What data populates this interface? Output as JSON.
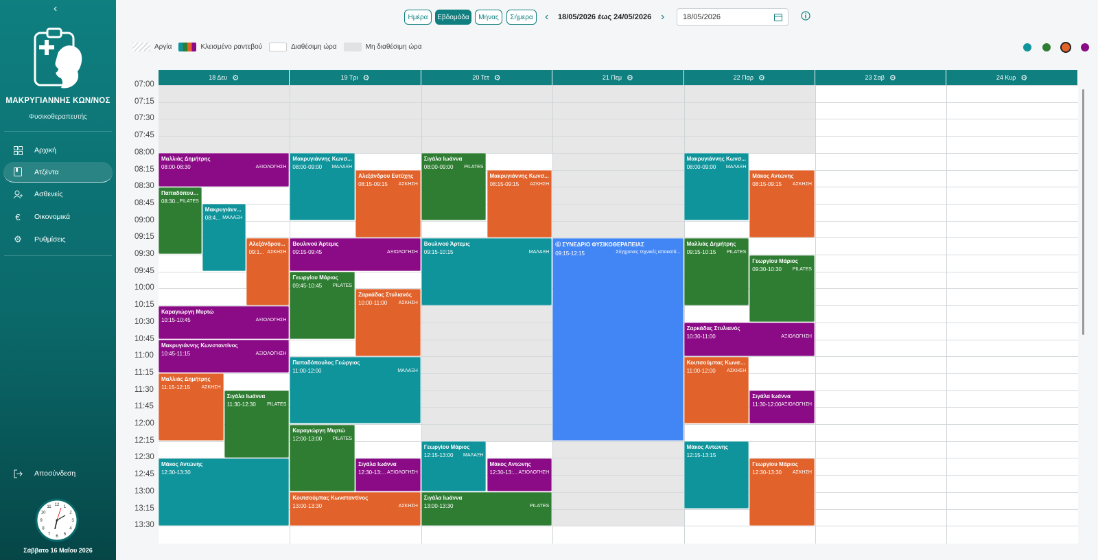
{
  "sidebar": {
    "collapse_icon": "‹",
    "doctor_name": "ΜΑΚΡΥΓΙΑΝΝΗΣ ΚΩΝ/ΝΟΣ",
    "doctor_role": "Φυσικοθεραπευτής",
    "items": [
      {
        "label": "Αρχική",
        "icon": "dashboard-icon"
      },
      {
        "label": "Ατζέντα",
        "icon": "calendar-icon",
        "active": true
      },
      {
        "label": "Ασθενείς",
        "icon": "patients-icon"
      },
      {
        "label": "Οικονομικά",
        "icon": "euro-icon"
      },
      {
        "label": "Ρυθμίσεις",
        "icon": "gear-icon"
      }
    ],
    "logout_label": "Αποσύνδεση",
    "clock_numbers": [
      "12",
      "1",
      "2",
      "3",
      "4",
      "5",
      "6",
      "7",
      "8",
      "9",
      "10",
      "11"
    ],
    "date_label": "Σάββατο 16 Μαΐου 2026"
  },
  "toolbar": {
    "view_buttons": [
      "Ημέρα",
      "Εβδομάδα",
      "Μήνας",
      "Σήμερα"
    ],
    "active_view": "Εβδομάδα",
    "prev": "‹",
    "next": "›",
    "range": "18/05/2026 έως 24/05/2026",
    "date_value": "18/05/2026"
  },
  "legend": {
    "holiday": "Αργία",
    "booked": "Κλεισμένο ραντεβού",
    "available": "Διαθέσιμη ώρα",
    "unavailable": "Μη διαθέσιμη ώρα"
  },
  "colors": {
    "primary": "#0f7f80",
    "purple": "#8b0a86",
    "teal": "#10949c",
    "orange": "#e1622a",
    "green": "#2e7d32",
    "blue": "#4285f4"
  },
  "filter_dots": [
    "#10949c",
    "#2e7d32",
    "#e1622a",
    "#8b0a86"
  ],
  "days": [
    "18 Δευ",
    "19 Τρι",
    "20 Τετ",
    "21 Πεμ",
    "22 Παρ",
    "23 Σαβ",
    "24 Κυρ"
  ],
  "times": [
    "07:00",
    "07:15",
    "07:30",
    "07:45",
    "08:00",
    "08:15",
    "08:30",
    "08:45",
    "09:00",
    "09:15",
    "09:30",
    "09:45",
    "10:00",
    "10:15",
    "10:30",
    "10:45",
    "11:00",
    "11:15",
    "11:30",
    "11:45",
    "12:00",
    "12:15",
    "12:30",
    "12:45",
    "13:00",
    "13:15",
    "13:30"
  ],
  "events": [
    {
      "day": 0,
      "start": "08:00",
      "end": "08:30",
      "sub": 0,
      "subs": 1,
      "color": "purple",
      "name": "Μαλλιάς Δημήτρης",
      "time": "08:00-08:30",
      "type": "ΑΞΙΟΛΟΓΗΣΗ"
    },
    {
      "day": 0,
      "start": "08:30",
      "end": "09:30",
      "sub": 0,
      "subs": 3,
      "color": "green",
      "name": "Παπαδόπουλ...",
      "time": "08:30...",
      "type": "PILATES"
    },
    {
      "day": 0,
      "start": "08:45",
      "end": "09:45",
      "sub": 1,
      "subs": 3,
      "color": "teal",
      "name": "Μακρυγιάνν...",
      "time": "08:4...",
      "type": "ΜΑΛΑΞΗ"
    },
    {
      "day": 0,
      "start": "09:15",
      "end": "10:15",
      "sub": 2,
      "subs": 3,
      "color": "orange",
      "name": "Αλεξάνδρου...",
      "time": "09:1...",
      "type": "ΑΣΚΗΣΗ"
    },
    {
      "day": 0,
      "start": "10:15",
      "end": "10:45",
      "sub": 0,
      "subs": 1,
      "color": "purple",
      "name": "Καραγιώργη Μυρτώ",
      "time": "10:15-10:45",
      "type": "ΑΞΙΟΛΟΓΗΣΗ"
    },
    {
      "day": 0,
      "start": "10:45",
      "end": "11:15",
      "sub": 0,
      "subs": 1,
      "color": "purple",
      "name": "Μακρυγιάννης Κωνσταντίνος",
      "time": "10:45-11:15",
      "type": "ΑΞΙΟΛΟΓΗΣΗ"
    },
    {
      "day": 0,
      "start": "11:15",
      "end": "12:15",
      "sub": 0,
      "subs": 2,
      "color": "orange",
      "name": "Μαλλιάς Δημήτρης",
      "time": "11:15-12:15",
      "type": "ΑΣΚΗΣΗ"
    },
    {
      "day": 0,
      "start": "11:30",
      "end": "12:30",
      "sub": 1,
      "subs": 2,
      "color": "green",
      "name": "Σιγάλα Ιωάννα",
      "time": "11:30-12:30",
      "type": "PILATES"
    },
    {
      "day": 0,
      "start": "12:30",
      "end": "13:30",
      "sub": 0,
      "subs": 1,
      "color": "teal",
      "name": "Μάκος Αντώνης",
      "time": "12:30-13:30",
      "type": ""
    },
    {
      "day": 1,
      "start": "08:00",
      "end": "09:00",
      "sub": 0,
      "subs": 2,
      "color": "teal",
      "name": "Μακρυγιάννης Κωνσ...",
      "time": "08:00-09:00",
      "type": "ΜΑΛΑΞΗ"
    },
    {
      "day": 1,
      "start": "08:15",
      "end": "09:15",
      "sub": 1,
      "subs": 2,
      "color": "orange",
      "name": "Αλεξάνδρου Ευτύχης",
      "time": "08:15-09:15",
      "type": "ΑΣΚΗΣΗ"
    },
    {
      "day": 1,
      "start": "09:15",
      "end": "09:45",
      "sub": 0,
      "subs": 1,
      "color": "purple",
      "name": "Βουλινού Άρτεμις",
      "time": "09:15-09:45",
      "type": "ΑΞΙΟΛΟΓΗΣΗ"
    },
    {
      "day": 1,
      "start": "09:45",
      "end": "10:45",
      "sub": 0,
      "subs": 2,
      "color": "green",
      "name": "Γεωργίου Μάριος",
      "time": "09:45-10:45",
      "type": "PILATES"
    },
    {
      "day": 1,
      "start": "10:00",
      "end": "11:00",
      "sub": 1,
      "subs": 2,
      "color": "orange",
      "name": "Ζαρκάδας Στυλιανός",
      "time": "10:00-11:00",
      "type": "ΑΣΚΗΣΗ"
    },
    {
      "day": 1,
      "start": "11:00",
      "end": "12:00",
      "sub": 0,
      "subs": 1,
      "color": "teal",
      "name": "Παπαδόπουλος Γεώργιος",
      "time": "11:00-12:00",
      "type": "ΜΑΛΑΞΗ"
    },
    {
      "day": 1,
      "start": "12:00",
      "end": "13:00",
      "sub": 0,
      "subs": 2,
      "color": "green",
      "name": "Καραγιώργη Μυρτώ",
      "time": "12:00-13:00",
      "type": "PILATES"
    },
    {
      "day": 1,
      "start": "12:30",
      "end": "13:00",
      "sub": 1,
      "subs": 2,
      "color": "purple",
      "name": "Σιγάλα Ιωάννα",
      "time": "12:30-13:...",
      "type": "ΑΞΙΟΛΟΓΗΣΗ"
    },
    {
      "day": 1,
      "start": "13:00",
      "end": "13:30",
      "sub": 0,
      "subs": 1,
      "color": "orange",
      "name": "Κουτσούμπας Κωνσταντίνος",
      "time": "13:00-13:30",
      "type": "ΑΣΚΗΣΗ"
    },
    {
      "day": 2,
      "start": "08:00",
      "end": "09:00",
      "sub": 0,
      "subs": 2,
      "color": "green",
      "name": "Σιγάλα Ιωάννα",
      "time": "08:00-09:00",
      "type": "PILATES"
    },
    {
      "day": 2,
      "start": "08:15",
      "end": "09:15",
      "sub": 1,
      "subs": 2,
      "color": "orange",
      "name": "Μακρυγιάννης Κωνσ...",
      "time": "08:15-09:15",
      "type": "ΑΣΚΗΣΗ"
    },
    {
      "day": 2,
      "start": "09:15",
      "end": "10:15",
      "sub": 0,
      "subs": 1,
      "color": "teal",
      "name": "Βουλινού Άρτεμις",
      "time": "09:15-10:15",
      "type": "ΜΑΛΑΞΗ"
    },
    {
      "day": 2,
      "start": "12:15",
      "end": "13:00",
      "sub": 0,
      "subs": 2,
      "color": "teal",
      "name": "Γεωργίου Μάριος",
      "time": "12:15-13:00",
      "type": "ΜΑΛΑΞΗ"
    },
    {
      "day": 2,
      "start": "12:30",
      "end": "13:00",
      "sub": 1,
      "subs": 2,
      "color": "purple",
      "name": "Μάκος Αντώνης",
      "time": "12:30-13:...",
      "type": "ΑΞΙΟΛΟΓΗΣΗ"
    },
    {
      "day": 2,
      "start": "13:00",
      "end": "13:30",
      "sub": 0,
      "subs": 1,
      "color": "green",
      "name": "Σιγάλα Ιωάννα",
      "time": "13:00-13:30",
      "type": "PILATES"
    },
    {
      "day": 3,
      "start": "09:15",
      "end": "12:15",
      "sub": 0,
      "subs": 1,
      "color": "blue",
      "name": "ΣΥΝΕΔΡΙΟ ΦΥΣΙΚΟΘΕΡΑΠΕΙΑΣ",
      "time": "09:15-12:15",
      "type": "Σύγχρονες τεχνικές αποκατά...",
      "google": true
    },
    {
      "day": 4,
      "start": "08:00",
      "end": "09:00",
      "sub": 0,
      "subs": 2,
      "color": "teal",
      "name": "Μακρυγιάννης Κωνσ...",
      "time": "08:00-09:00",
      "type": "ΜΑΛΑΞΗ"
    },
    {
      "day": 4,
      "start": "08:15",
      "end": "09:15",
      "sub": 1,
      "subs": 2,
      "color": "orange",
      "name": "Μάκος Αντώνης",
      "time": "08:15-09:15",
      "type": "ΑΣΚΗΣΗ"
    },
    {
      "day": 4,
      "start": "09:15",
      "end": "10:15",
      "sub": 0,
      "subs": 2,
      "color": "green",
      "name": "Μαλλιάς Δημήτρης",
      "time": "09:15-10:15",
      "type": "PILATES"
    },
    {
      "day": 4,
      "start": "09:30",
      "end": "10:30",
      "sub": 1,
      "subs": 2,
      "color": "green",
      "name": "Γεωργίου Μάριος",
      "time": "09:30-10:30",
      "type": "PILATES"
    },
    {
      "day": 4,
      "start": "10:30",
      "end": "11:00",
      "sub": 0,
      "subs": 1,
      "color": "purple",
      "name": "Ζαρκάδας Στυλιανός",
      "time": "10:30-11:00",
      "type": "ΑΞΙΟΛΟΓΗΣΗ"
    },
    {
      "day": 4,
      "start": "11:00",
      "end": "12:00",
      "sub": 0,
      "subs": 2,
      "color": "orange",
      "name": "Κουτσούμπας Κωνστ...",
      "time": "11:00-12:00",
      "type": "ΑΣΚΗΣΗ"
    },
    {
      "day": 4,
      "start": "11:30",
      "end": "12:00",
      "sub": 1,
      "subs": 2,
      "color": "purple",
      "name": "Σιγάλα Ιωάννα",
      "time": "11:30-12:00",
      "type": "ΑΞΙΟΛΟΓΗΣΗ"
    },
    {
      "day": 4,
      "start": "12:15",
      "end": "13:15",
      "sub": 0,
      "subs": 2,
      "color": "teal",
      "name": "Μάκος Αντώνης",
      "time": "12:15-13:15",
      "type": ""
    },
    {
      "day": 4,
      "start": "12:30",
      "end": "13:30",
      "sub": 1,
      "subs": 2,
      "color": "orange",
      "name": "Γεωργίου Μάριος",
      "time": "12:30-13:30",
      "type": "ΑΣΚΗΣΗ"
    }
  ],
  "unavailable": [
    {
      "day": 0,
      "start": "07:00",
      "end": "08:00"
    },
    {
      "day": 1,
      "start": "07:00",
      "end": "08:00"
    },
    {
      "day": 2,
      "start": "07:00",
      "end": "08:00"
    },
    {
      "day": 2,
      "start": "10:15",
      "end": "12:15"
    },
    {
      "day": 3,
      "start": "07:00",
      "end": "13:30"
    },
    {
      "day": 4,
      "start": "07:00",
      "end": "08:00"
    }
  ]
}
